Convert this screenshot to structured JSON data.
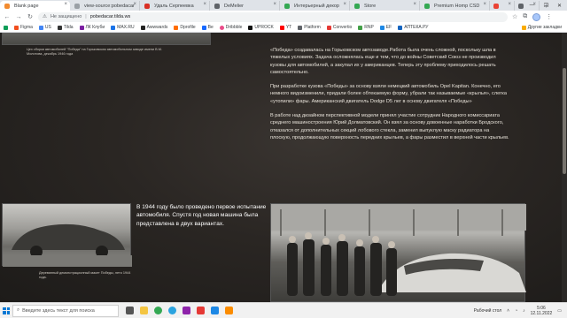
{
  "browser": {
    "tabs": [
      {
        "label": "Blank page",
        "active": true,
        "color": "#f28b30"
      },
      {
        "label": "view-source:pobedacar",
        "active": false,
        "color": "#9aa0a6"
      },
      {
        "label": "Удаль Серпеевка",
        "active": false,
        "color": "#d93025"
      },
      {
        "label": "DeMelier",
        "active": false,
        "color": "#5f6368"
      },
      {
        "label": "Интерьерный декор",
        "active": false,
        "color": "#34a853"
      },
      {
        "label": "Store",
        "active": false,
        "color": "#34a853"
      },
      {
        "label": "Premium Homp CSD",
        "active": false,
        "color": "#34a853"
      },
      {
        "label": "",
        "active": false,
        "color": "#ea4335"
      },
      {
        "label": "",
        "active": false,
        "color": "#5f6368"
      }
    ],
    "address": {
      "security": "Не защищено",
      "url": "pobedacar.tilda.ws"
    },
    "bookmarks": [
      {
        "label": "",
        "color": "#0f9d58"
      },
      {
        "label": "Figma",
        "color": "#f24e1e"
      },
      {
        "label": "US",
        "color": "#4285f4"
      },
      {
        "label": "Tilda",
        "color": "#333333"
      },
      {
        "label": "ЛК Клуби",
        "color": "#7b1fa2"
      },
      {
        "label": "MAX.RU",
        "color": "#1a73e8"
      },
      {
        "label": "Awwwards",
        "color": "#222222"
      },
      {
        "label": "Dprofile",
        "color": "#ff6d00"
      },
      {
        "label": "Be",
        "color": "#1769ff"
      },
      {
        "label": "Dribbble",
        "color": "#ea4c89"
      },
      {
        "label": "UPROCK",
        "color": "#111111"
      },
      {
        "label": "YT",
        "color": "#ff0000"
      },
      {
        "label": "Platform",
        "color": "#5f6368"
      },
      {
        "label": "Convertio",
        "color": "#e53935"
      },
      {
        "label": "RNP",
        "color": "#43a047"
      },
      {
        "label": "EF",
        "color": "#1e88e5"
      },
      {
        "label": "АПТЕКА.РУ",
        "color": "#1565c0"
      }
    ],
    "bookmarks_other": "Другие закладки"
  },
  "page": {
    "top_caption": "Цех сборки автомобилей \"Победа\" на Горьковском автомобильном заводе имени В.М. Молотова, декабрь 1946 года",
    "para1": "«Победа» создавалась на Горьковском автозаводе.Работа была очень сложной, поскольку шла в тяжелых условиях. Задача осложнялась еще и тем, что до войны Советский Союз не производил кузовы для автомобилей, а закупал их у американцев. Теперь эту проблему приходилось решать самостоятельно.",
    "para2": "При разработке кузова «Победы» за основу взяли немецкий автомобиль Opel Kapitan. Конечно, его немного видоизменили, придали более обтекаемую форму, убрали так называемые «крылья», слегка «утопили» фары. Американский двигатель Dodge D5 лег в основу двигателя «Победы»",
    "para3": "В работе над дизайном перспективной модели принял участие сотрудник Народного комиссариата среднего машиностроения Юрий Долматовский. Он взял за основу довоенные наработки Бродского, отказался от дополнительных секций лобового стекла, заменил выпуклую маску радиатора на плоскую, продолжающую поверхность передних крыльев, а фары разместил в верхней части крыльев.",
    "year_text": "В 1944 году было проведено первое испытание автомобиля. Спустя год новая машина была представлена в двух вариантах.",
    "bottom_caption": "Деревянный демонстрационный макет Победы, лето 1944 года."
  },
  "taskbar": {
    "search_placeholder": "Введите здесь текст для поиска",
    "tray_label": "Рабочий стол",
    "time": "5:06",
    "date": "12.11.2022"
  }
}
